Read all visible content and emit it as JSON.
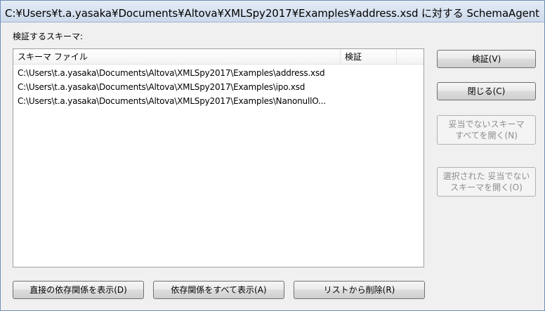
{
  "window": {
    "title": "C:¥Users¥t.a.yasaka¥Documents¥Altova¥XMLSpy2017¥Examples¥address.xsd に対する SchemaAgent ..."
  },
  "schema_section": {
    "label": "検証するスキーマ:"
  },
  "table": {
    "columns": [
      "スキーマ ファイル",
      "検証"
    ],
    "rows": [
      {
        "file": "C:\\Users\\t.a.yasaka\\Documents\\Altova\\XMLSpy2017\\Examples\\address.xsd"
      },
      {
        "file": "C:\\Users\\t.a.yasaka\\Documents\\Altova\\XMLSpy2017\\Examples\\ipo.xsd"
      },
      {
        "file": "C:\\Users\\t.a.yasaka\\Documents\\Altova\\XMLSpy2017\\Examples\\NanonullO..."
      }
    ]
  },
  "buttons": {
    "validate": "検証(V)",
    "close": "閉じる(C)",
    "open_invalid_line1": "妥当でないスキーマ",
    "open_invalid_line2": "すべてを開く(N)",
    "open_selected_line1": "選択された 妥当でない",
    "open_selected_line2": "スキーマを開く(O)",
    "show_direct": "直接の依存関係を表示(D)",
    "show_all": "依存関係をすべて表示(A)",
    "remove": "リストから削除(R)"
  }
}
